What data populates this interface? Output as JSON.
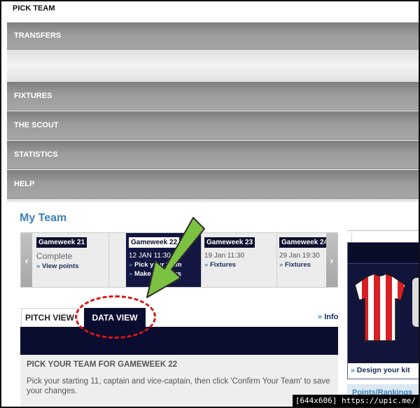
{
  "nav": {
    "pick_team": "PICK TEAM",
    "transfers": "TRANSFERS",
    "fixtures": "FIXTURES",
    "scout": "THE SCOUT",
    "statistics": "STATISTICS",
    "help": "HELP"
  },
  "my_team": {
    "title": "My Team"
  },
  "gameweeks": [
    {
      "title": "Gameweek 21",
      "status": "Complete",
      "link": "View points"
    },
    {
      "title": "Gameweek 22",
      "date": "12 JAN 11:30",
      "link1": "Pick your team",
      "link2": "Make transfers"
    },
    {
      "title": "Gameweek 23",
      "date": "19 Jan 11:30",
      "link": "Fixtures"
    },
    {
      "title": "Gameweek 24",
      "date": "29 Jan 19:30",
      "link": "Fixtures"
    }
  ],
  "tabs": {
    "pitch_view": "PITCH VIEW",
    "data_view": "DATA VIEW",
    "info": "Info"
  },
  "notice": {
    "title": "PICK YOUR TEAM FOR GAMEWEEK 22",
    "text": "Pick your starting 11, captain and vice-captain, then click 'Confirm Your Team' to save your changes."
  },
  "sidebar": {
    "design_kit": "Design your kit",
    "points_rankings": "Points/Rankings"
  },
  "watermark": "[644x606] https://upic.me/",
  "colors": {
    "accent_blue": "#3f80b8",
    "navy": "#0b0d30",
    "highlight_red": "#d41717",
    "arrow_green": "#7cc242"
  }
}
